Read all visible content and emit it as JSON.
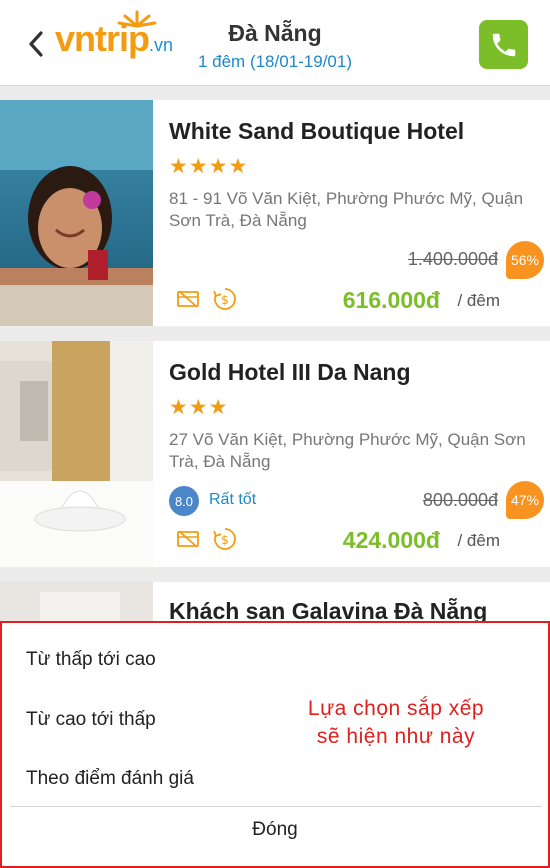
{
  "header": {
    "logo_vn": "vn",
    "logo_trip": "trip",
    "logo_suffix": ".vn",
    "city": "Đà Nẵng",
    "dates": "1 đêm (18/01-19/01)"
  },
  "hotels": [
    {
      "name": "White Sand Boutique Hotel",
      "stars": "★★★★",
      "address": "81 - 91 Võ Văn Kiệt, Phường Phước Mỹ, Quận Sơn Trà, Đà Nẵng",
      "old_price": "1.400.000đ",
      "discount": "56%",
      "price": "616.000đ",
      "per_night": "/ đêm"
    },
    {
      "name": "Gold Hotel III Da Nang",
      "stars": "★★★",
      "address": "27 Võ Văn Kiệt, Phường Phước Mỹ, Quận Sơn Trà, Đà Nẵng",
      "score": "8.0",
      "score_label": "Rất tốt",
      "old_price": "800.000đ",
      "discount": "47%",
      "price": "424.000đ",
      "per_night": "/ đêm"
    },
    {
      "name": "Khách san Galavina Đà Nẵng"
    }
  ],
  "sort_sheet": {
    "options": [
      "Từ thấp tới cao",
      "Từ cao tới thấp",
      "Theo điểm đánh giá"
    ],
    "close_label": "Đóng",
    "note_line1": "Lựa chọn sắp xếp",
    "note_line2": "sẽ hiện như này"
  },
  "colors": {
    "brand_orange": "#f39c12",
    "brand_blue": "#1e88c9",
    "price_green": "#7cbd2a",
    "annotation_red": "#e0201f"
  }
}
